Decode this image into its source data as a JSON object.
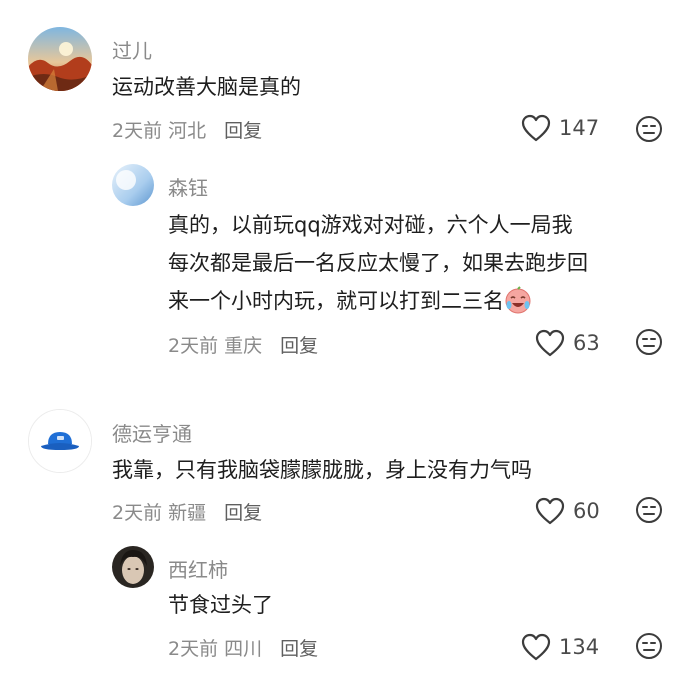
{
  "comments": [
    {
      "name": "过儿",
      "text_lines": [
        "运动改善大脑是真的"
      ],
      "time": "2天前",
      "location": "河北",
      "reply_label": "回复",
      "likes": "147"
    },
    {
      "name": "森钰",
      "text_lines": [
        "真的，以前玩qq游戏对对碰，六个人一局我",
        "每次都是最后一名反应太慢了，如果去跑步回",
        "来一个小时内玩，就可以打到二三名"
      ],
      "time": "2天前",
      "location": "重庆",
      "reply_label": "回复",
      "likes": "63",
      "emoji_icon": "crying-laughing-emoji-icon"
    },
    {
      "name": "德运亨通",
      "text_lines": [
        "我靠，只有我脑袋朦朦胧胧，身上没有力气吗"
      ],
      "time": "2天前",
      "location": "新疆",
      "reply_label": "回复",
      "likes": "60"
    },
    {
      "name": "西红柿",
      "text_lines": [
        "节食过头了"
      ],
      "time": "2天前",
      "location": "四川",
      "reply_label": "回复",
      "likes": "134"
    }
  ],
  "colors": {
    "name_gray": "#8a8a8a",
    "text": "#1e1e1e",
    "icon_stroke": "#3c3c3c"
  }
}
